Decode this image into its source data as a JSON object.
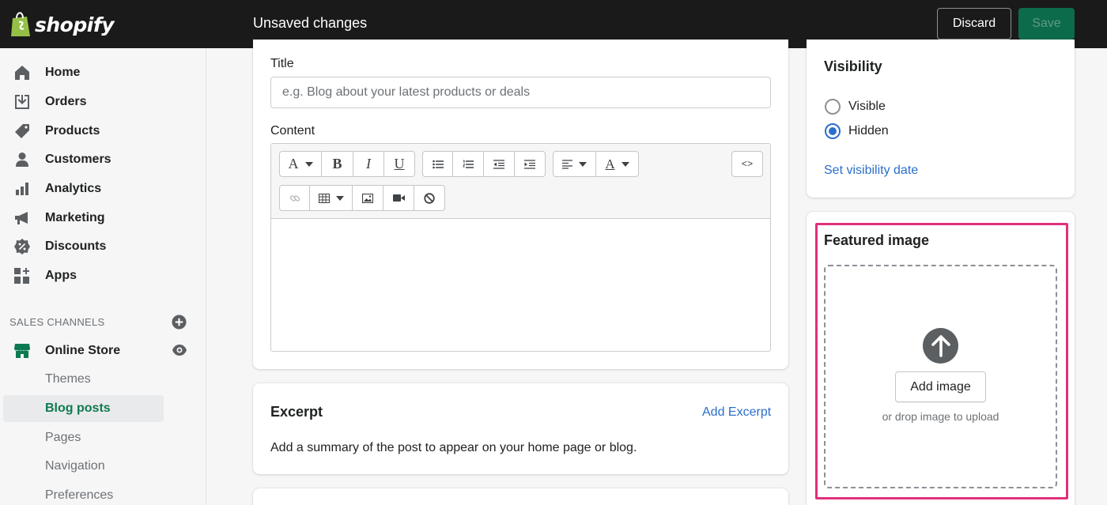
{
  "header": {
    "logo_text": "shopify",
    "status": "Unsaved changes",
    "discard_label": "Discard",
    "save_label": "Save"
  },
  "sidebar": {
    "items": [
      {
        "label": "Home",
        "icon": "home-icon"
      },
      {
        "label": "Orders",
        "icon": "orders-icon"
      },
      {
        "label": "Products",
        "icon": "tag-icon"
      },
      {
        "label": "Customers",
        "icon": "person-icon"
      },
      {
        "label": "Analytics",
        "icon": "bar-chart-icon"
      },
      {
        "label": "Marketing",
        "icon": "megaphone-icon"
      },
      {
        "label": "Discounts",
        "icon": "discount-icon"
      },
      {
        "label": "Apps",
        "icon": "apps-icon"
      }
    ],
    "sales_channels_heading": "SALES CHANNELS",
    "online_store_label": "Online Store",
    "sub_items": [
      {
        "label": "Themes",
        "active": false
      },
      {
        "label": "Blog posts",
        "active": true
      },
      {
        "label": "Pages",
        "active": false
      },
      {
        "label": "Navigation",
        "active": false
      },
      {
        "label": "Preferences",
        "active": false
      }
    ],
    "active_color": "#0e7a52"
  },
  "main": {
    "title_label": "Title",
    "title_placeholder": "e.g. Blog about your latest products or deals",
    "title_value": "",
    "content_label": "Content",
    "code_button": "<>",
    "excerpt": {
      "heading": "Excerpt",
      "action": "Add Excerpt",
      "description": "Add a summary of the post to appear on your home page or blog."
    }
  },
  "visibility": {
    "heading": "Visibility",
    "options": [
      {
        "label": "Visible",
        "checked": false
      },
      {
        "label": "Hidden",
        "checked": true
      }
    ],
    "set_date_link": "Set visibility date"
  },
  "featured_image": {
    "heading": "Featured image",
    "add_button": "Add image",
    "hint": "or drop image to upload",
    "highlight_color": "#e0307a"
  },
  "colors": {
    "topbar": "#1a1a1a",
    "save_button": "#0c6b4a",
    "link": "#2c6ecb"
  }
}
